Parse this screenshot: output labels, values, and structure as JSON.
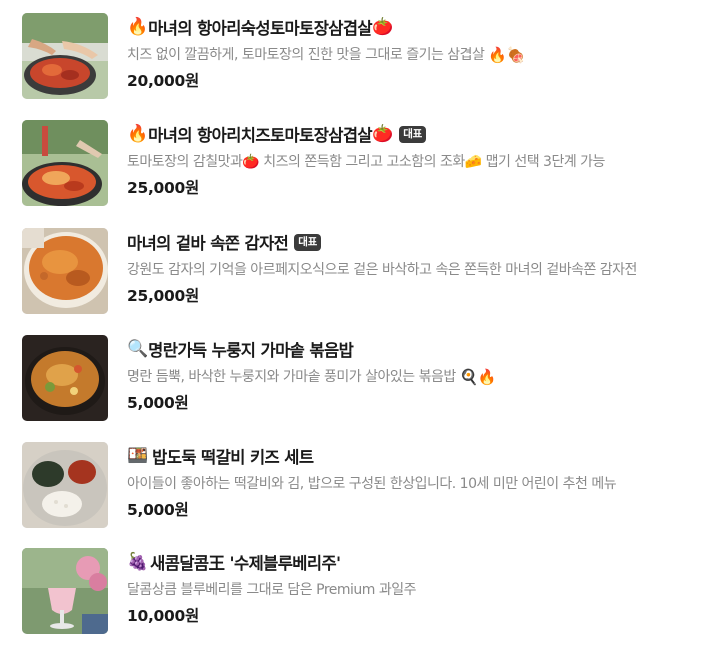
{
  "menu": {
    "items": [
      {
        "name": "마녀의 항아리숙성토마토장삼겹살",
        "description": "치즈 없이 깔끔하게, 토마토장의 진한 맛을 그대로 즐기는 삼겹살",
        "price": "20,000원",
        "badge": "",
        "prefix_icon": "🔥",
        "suffix_icon": "🍅",
        "desc_icons": "🔥🍖"
      },
      {
        "name": "마녀의 항아리치즈토마토장삼겹살",
        "description": "토마토장의 감칠맛과🍅 치즈의 쫀득함 그리고 고소함의 조화🧀 맵기 선택 3단계 가능",
        "price": "25,000원",
        "badge": "대표",
        "prefix_icon": "🔥",
        "suffix_icon": "🍅",
        "desc_icons": ""
      },
      {
        "name": "마녀의 겉바 속쫀 감자전",
        "description": "강원도 감자의 기억을 아르페지오식으로 겉은 바삭하고 속은 쫀득한 마녀의 겉바속쫀 감자전",
        "price": "25,000원",
        "badge": "대표",
        "prefix_icon": "",
        "suffix_icon": "",
        "desc_icons": ""
      },
      {
        "name": "명란가득 누룽지 가마솥 볶음밥",
        "description": "명란 듬뿍, 바삭한 누룽지와 가마솥 풍미가 살아있는 볶음밥",
        "price": "5,000원",
        "badge": "",
        "prefix_icon": "🔍",
        "suffix_icon": "",
        "desc_icons": "🍳🔥"
      },
      {
        "name": "밥도둑 떡갈비 키즈 세트",
        "description": "아이들이 좋아하는 떡갈비와 김, 밥으로 구성된 한상입니다. 10세 미만 어린이 추천 메뉴",
        "price": "5,000원",
        "badge": "",
        "prefix_icon": "🍱",
        "suffix_icon": "",
        "desc_icons": ""
      },
      {
        "name": "새콤달콤王 '수제블루베리주'",
        "description": "달콤상큼 블루베리를 그대로 담은 Premium 과일주",
        "price": "10,000원",
        "badge": "",
        "prefix_icon": "🍇",
        "suffix_icon": "",
        "desc_icons": ""
      }
    ]
  }
}
